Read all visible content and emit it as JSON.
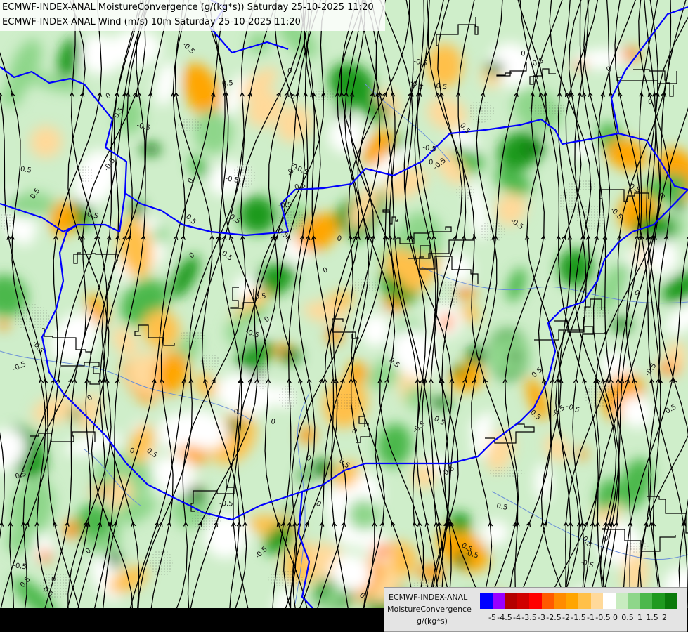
{
  "titles": {
    "line1": "ECMWF-INDEX-ANAL MoistureConvergence (g/(kg*s)) Saturday 25-10-2025 11:20",
    "line2": "ECMWF-INDEX-ANAL Wind (m/s) 10m Saturday 25-10-2025 11:20"
  },
  "legend": {
    "model": "ECMWF-INDEX-ANAL",
    "parameter": "MoistureConvergence",
    "unit": "g/(kg*s)",
    "tick_labels": [
      "-5",
      "-4.5",
      "-4",
      "-3.5",
      "-3",
      "-2.5",
      "-2",
      "-1.5",
      "-1",
      "-0.5",
      "0",
      "0.5",
      "1",
      "1.5",
      "2"
    ],
    "colors": [
      "#0000ff",
      "#9900ff",
      "#b40000",
      "#d00000",
      "#ff0000",
      "#ff5a00",
      "#ff8c00",
      "#ffa500",
      "#ffc04a",
      "#ffd99a",
      "#ffffff",
      "#c8ecc0",
      "#8ed68a",
      "#4cb84c",
      "#1f9a1f",
      "#0a7a0a"
    ]
  },
  "contour_labels": [
    "0",
    "0.5",
    "-0.5"
  ],
  "colors": {
    "border": "#0000ff",
    "streamline": "#000000",
    "river": "#6a8fd8",
    "background_bar": "#000000"
  }
}
